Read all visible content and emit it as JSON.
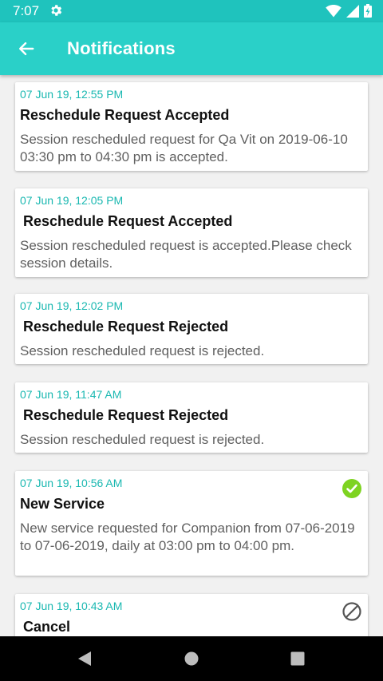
{
  "status_bar": {
    "time": "7:07",
    "icons": [
      "settings-gear-icon",
      "wifi-icon",
      "signal-icon",
      "battery-charging-icon"
    ]
  },
  "app_bar": {
    "title": "Notifications",
    "back_icon": "arrow-left-icon"
  },
  "notifications": [
    {
      "date": "07 Jun 19, 12:55 PM",
      "title": "Reschedule Request Accepted",
      "message": "Session rescheduled request for Qa  Vit on 2019-06-10 03:30 pm to 04:30 pm is accepted."
    },
    {
      "date": "07 Jun 19, 12:05 PM",
      "title": " Reschedule Request Accepted",
      "message": "Session rescheduled request is accepted.Please check session details."
    },
    {
      "date": "07 Jun 19, 12:02 PM",
      "title": " Reschedule Request Rejected",
      "message": "Session rescheduled request is rejected."
    },
    {
      "date": "07 Jun 19, 11:47 AM",
      "title": " Reschedule Request Rejected",
      "message": "Session rescheduled request is rejected."
    },
    {
      "date": "07 Jun 19, 10:56 AM",
      "title": "New Service",
      "message": "New service requested for Companion from 07-06-2019 to 07-06-2019, daily at 03:00 pm to 04:00 pm.",
      "status_icon": "check-circle-icon",
      "status_color": "#7ed321"
    },
    {
      "date": "07 Jun 19, 10:43 AM",
      "title": " Cancel",
      "message": "",
      "status_icon": "cancel-circle-icon",
      "status_color": "#555555"
    }
  ],
  "nav_bar": {
    "icons": [
      "back-triangle-icon",
      "home-circle-icon",
      "recents-square-icon"
    ]
  },
  "colors": {
    "status_bar": "#1fc3bd",
    "app_bar": "#2ad0c8",
    "date_text": "#1ab8b1"
  }
}
